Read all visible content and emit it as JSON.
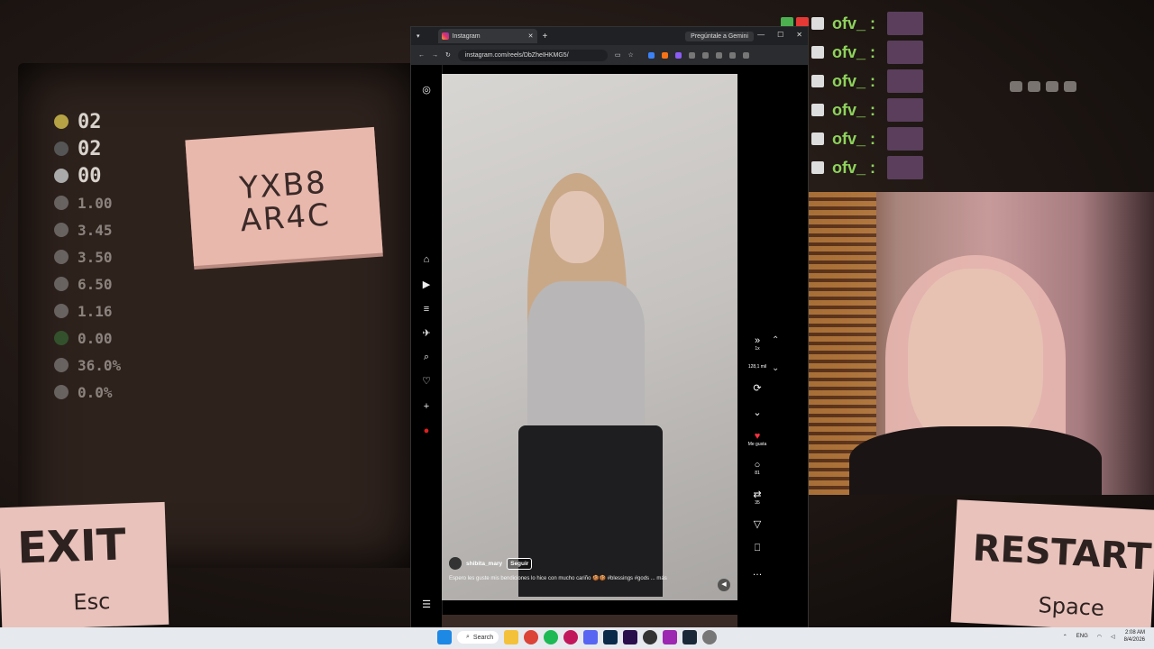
{
  "game": {
    "stats": [
      "02",
      "02",
      "00"
    ],
    "substats": [
      "1.00",
      "3.45",
      "3.50",
      "6.50",
      "1.16",
      "0.00",
      "36.0%",
      "0.0%"
    ],
    "seed_line1": "YXB8",
    "seed_line2": "AR4C",
    "exit_label": "EXIT",
    "exit_key": "Esc",
    "restart_label": "RESTART!",
    "restart_key": "Space"
  },
  "chat": {
    "name": "ofv_ :",
    "rows": 6
  },
  "browser": {
    "tab_title": "Instagram",
    "new_tab": "+",
    "gemini_label": "Pregúntale a Gemini",
    "url": "instagram.com/reels/DbZheIHKMG5/"
  },
  "reel": {
    "username": "shibita_mary",
    "follow_label": "Seguir",
    "description": "Espero les guste mis bendiciones lo hice con mucho cariño 🍪🍪 #blessings #gods ... más",
    "speed": "1x",
    "views": "128,1 mil",
    "likes_label": "Me gusta",
    "comments": "81",
    "reposts": "35"
  },
  "taskbar": {
    "search_label": "Search",
    "lang": "ENG",
    "time": "2:08 AM",
    "date": "8/4/2026"
  },
  "colors": {
    "accent_green": "#8ed35c",
    "seed_paper": "#e9b8ad",
    "instagram_like": "#ff3040"
  }
}
